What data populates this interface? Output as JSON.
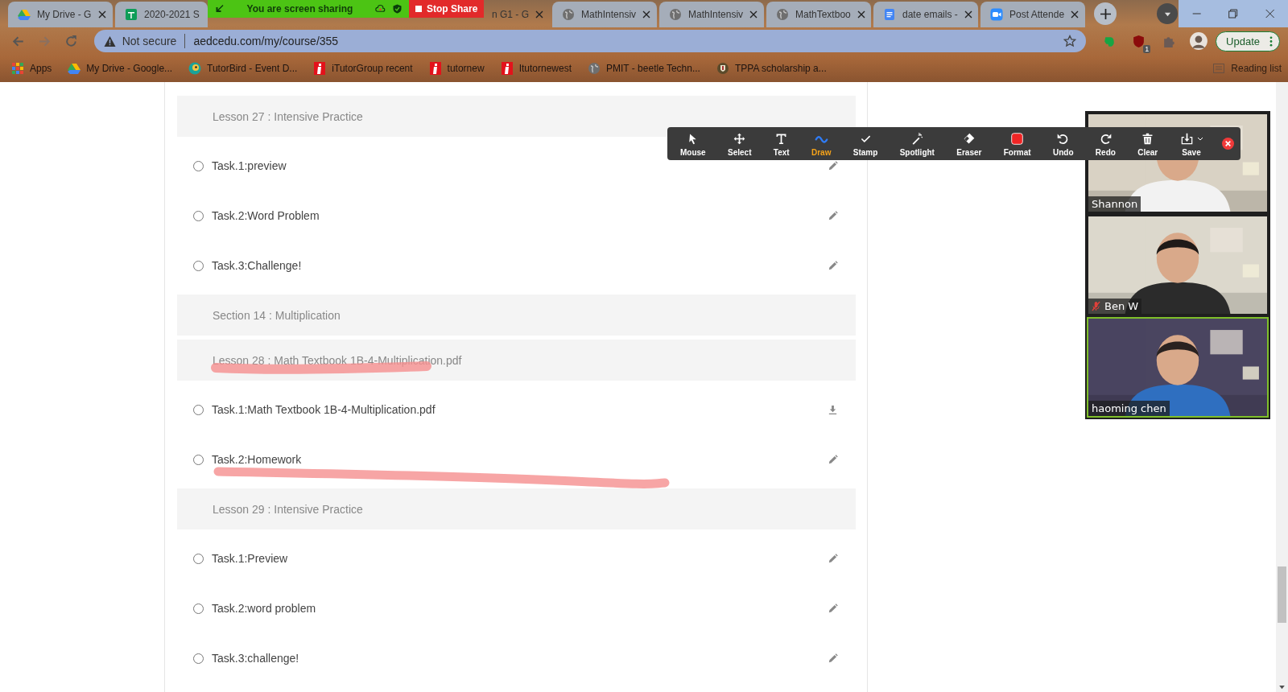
{
  "sharing_bar": {
    "message": "You are screen sharing",
    "stop_button": "Stop Share"
  },
  "tabs": [
    {
      "label": "My Drive - G",
      "kind": "drive",
      "close_button": true,
      "selected": false
    },
    {
      "label": "2020-2021 S",
      "kind": "sheets",
      "close_button": false,
      "selected": false
    },
    {
      "label": "n G1 - G",
      "kind": "none",
      "close_button": true,
      "selected": true
    },
    {
      "label": "MathIntensiv",
      "kind": "globe",
      "close_button": true,
      "selected": false
    },
    {
      "label": "MathIntensiv",
      "kind": "globe",
      "close_button": true,
      "selected": false
    },
    {
      "label": "MathTextboo",
      "kind": "globe",
      "close_button": true,
      "selected": false
    },
    {
      "label": "date emails -",
      "kind": "docs",
      "close_button": true,
      "selected": false
    },
    {
      "label": "Post Attende",
      "kind": "zoom",
      "close_button": true,
      "selected": false
    }
  ],
  "address_bar": {
    "security": "Not secure",
    "url": "aedcedu.com/my/course/355"
  },
  "extension_badge": "1",
  "update_button": "Update",
  "bookmarks": [
    {
      "label": "Apps",
      "kind": "apps"
    },
    {
      "label": "My Drive - Google...",
      "kind": "drive"
    },
    {
      "label": "TutorBird - Event D...",
      "kind": "bird"
    },
    {
      "label": "iTutorGroup recent",
      "kind": "itutor"
    },
    {
      "label": "tutornew",
      "kind": "itutor"
    },
    {
      "label": "Itutornewest",
      "kind": "itutor"
    },
    {
      "label": "PMIT - beetle Techn...",
      "kind": "globe"
    },
    {
      "label": "TPPA scholarship a...",
      "kind": "crest"
    }
  ],
  "reading_list": "Reading list",
  "course": [
    {
      "kind": "header",
      "title": "Lesson 27 : Intensive Practice"
    },
    {
      "kind": "edit_task",
      "title": "Task.1:preview",
      "checked": false
    },
    {
      "kind": "edit_task",
      "title": "Task.2:Word Problem",
      "checked": false
    },
    {
      "kind": "edit_task",
      "title": "Task.3:Challenge!",
      "checked": false
    },
    {
      "kind": "header",
      "title": "Section 14 : Multiplication"
    },
    {
      "kind": "header",
      "title": "Lesson 28 : Math Textbook 1B-4-Multiplication.pdf"
    },
    {
      "kind": "download_task",
      "title": "Task.1:Math Textbook 1B-4-Multiplication.pdf",
      "checked": false
    },
    {
      "kind": "edit_task",
      "title": "Task.2:Homework",
      "checked": false
    },
    {
      "kind": "header",
      "title": "Lesson 29 : Intensive Practice"
    },
    {
      "kind": "edit_task",
      "title": "Task.1:Preview",
      "checked": false
    },
    {
      "kind": "edit_task",
      "title": "Task.2:word problem",
      "checked": false
    },
    {
      "kind": "edit_task",
      "title": "Task.3:challenge!",
      "checked": false
    }
  ],
  "annotation_toolbar": [
    {
      "label": "Mouse",
      "kind": "pointer",
      "selected": false
    },
    {
      "label": "Select",
      "kind": "move",
      "selected": false
    },
    {
      "label": "Text",
      "kind": "text",
      "selected": false
    },
    {
      "label": "Draw",
      "kind": "wave",
      "selected": true
    },
    {
      "label": "Stamp",
      "kind": "check",
      "selected": false
    },
    {
      "label": "Spotlight",
      "kind": "wand",
      "selected": false
    },
    {
      "label": "Eraser",
      "kind": "eraser",
      "selected": false
    },
    {
      "label": "Format",
      "kind": "swatch",
      "selected": false
    },
    {
      "label": "Undo",
      "kind": "undo",
      "selected": false
    },
    {
      "label": "Redo",
      "kind": "redo",
      "selected": false
    },
    {
      "label": "Clear",
      "kind": "trash",
      "selected": false
    },
    {
      "label": "Save",
      "kind": "save",
      "selected": false
    }
  ],
  "participants": [
    {
      "name": "Shannon",
      "muted": false,
      "active": false
    },
    {
      "name": "Ben W",
      "muted": true,
      "active": false
    },
    {
      "name": "haoming chen",
      "muted": false,
      "active": true
    }
  ]
}
